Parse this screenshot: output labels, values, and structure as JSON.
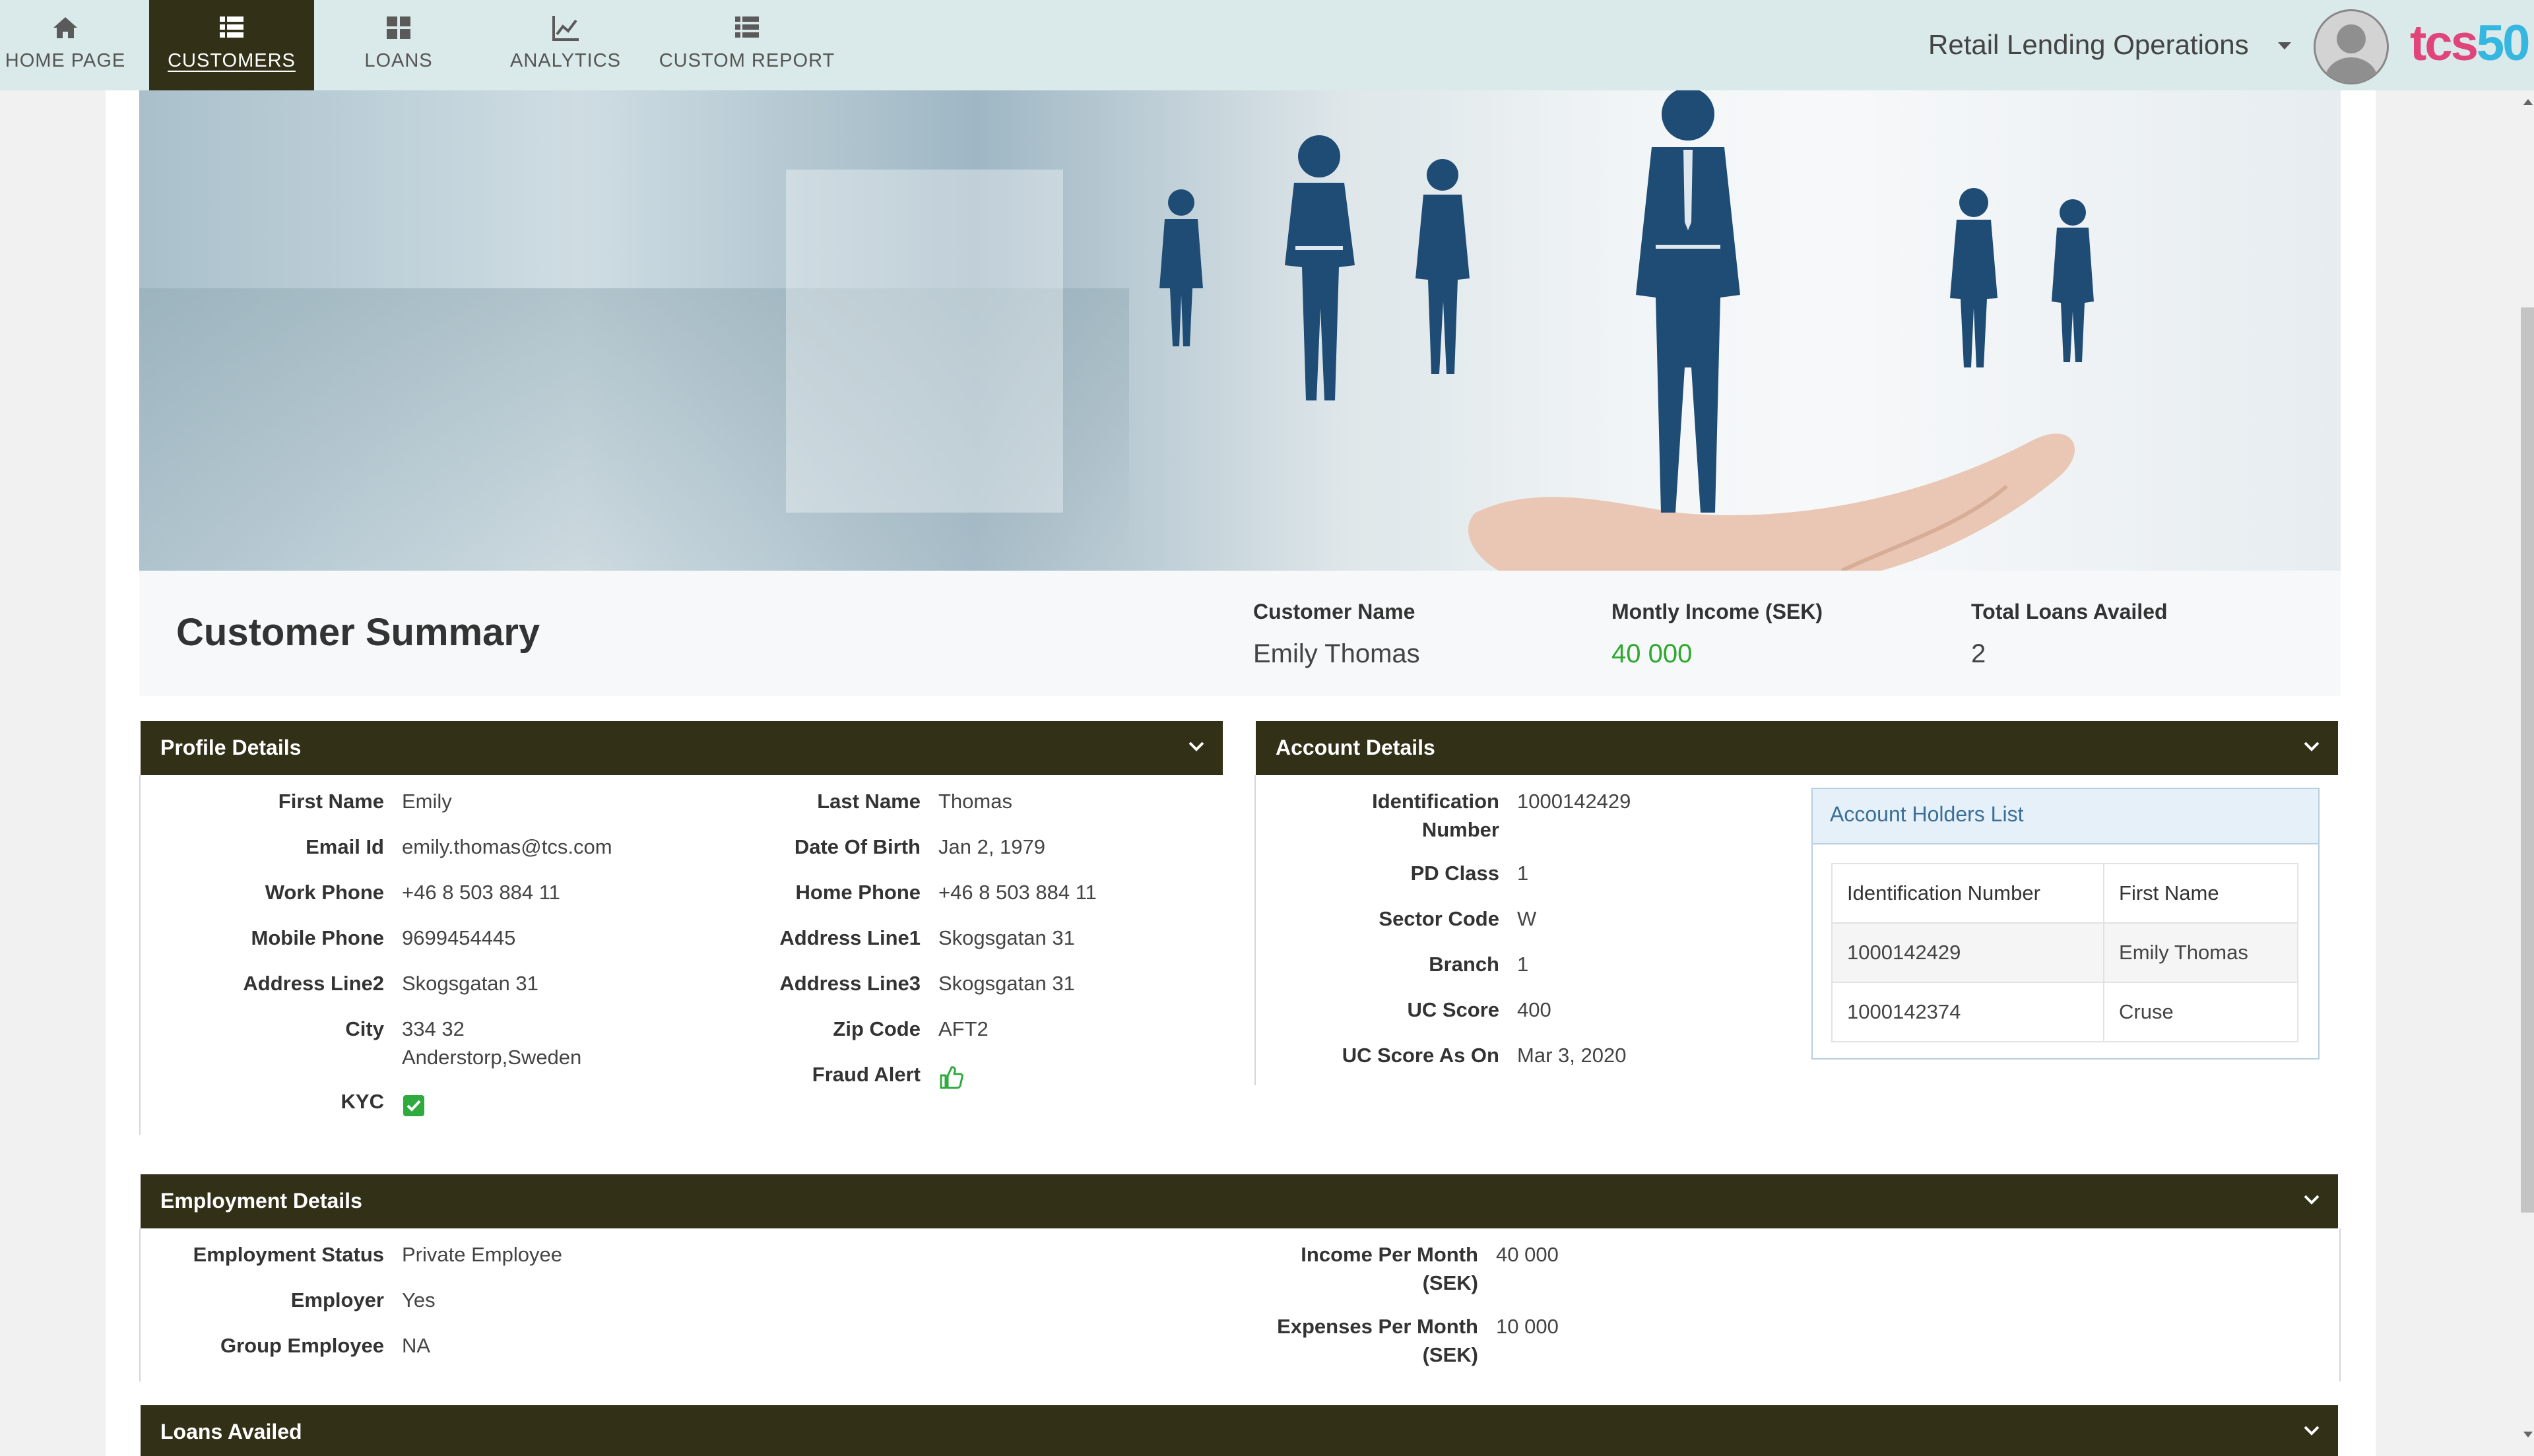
{
  "nav": {
    "items": [
      {
        "label": "HOME PAGE",
        "icon": "home-icon"
      },
      {
        "label": "CUSTOMERS",
        "icon": "list-icon",
        "active": true
      },
      {
        "label": "LOANS",
        "icon": "grid-icon"
      },
      {
        "label": "ANALYTICS",
        "icon": "line-chart-icon"
      },
      {
        "label": "CUSTOM REPORT",
        "icon": "list-icon"
      }
    ],
    "workspace": "Retail Lending Operations",
    "logo_left": "tcs",
    "logo_right": "50"
  },
  "summary": {
    "title": "Customer Summary",
    "customer_name_label": "Customer Name",
    "customer_name": "Emily Thomas",
    "income_label": "Montly Income (SEK)",
    "income": "40 000",
    "loans_label": "Total Loans Availed",
    "loans": "2"
  },
  "profile": {
    "title": "Profile Details",
    "first_name_label": "First Name",
    "first_name": "Emily",
    "last_name_label": "Last Name",
    "last_name": "Thomas",
    "email_label": "Email Id",
    "email": "emily.thomas@tcs.com",
    "dob_label": "Date Of Birth",
    "dob": "Jan 2, 1979",
    "work_phone_label": "Work Phone",
    "work_phone": "+46 8 503 884 11",
    "home_phone_label": "Home Phone",
    "home_phone": "+46 8 503 884 11",
    "mobile_label": "Mobile Phone",
    "mobile": "9699454445",
    "address1_label": "Address Line1",
    "address1": "Skogsgatan 31",
    "address2_label": "Address Line2",
    "address2": "Skogsgatan 31",
    "address3_label": "Address Line3",
    "address3": "Skogsgatan 31",
    "city_label": "City",
    "city_line1": "334 32",
    "city_line2": "Anderstorp,Sweden",
    "zip_label": "Zip Code",
    "zip": "AFT2",
    "kyc_label": "KYC",
    "kyc_checked": true,
    "fraud_label": "Fraud Alert",
    "fraud_icon": "thumbs-up-icon"
  },
  "account": {
    "title": "Account Details",
    "id_label_1": "Identification",
    "id_label_2": "Number",
    "id": "1000142429",
    "pd_label": "PD Class",
    "pd": "1",
    "sector_label": "Sector Code",
    "sector": "W",
    "branch_label": "Branch",
    "branch": "1",
    "uc_label": "UC Score",
    "uc": "400",
    "uc_asof_label": "UC Score As On",
    "uc_asof": "Mar 3, 2020",
    "holders": {
      "title": "Account Holders List",
      "columns": [
        "Identification Number",
        "First Name"
      ],
      "rows": [
        [
          "1000142429",
          "Emily Thomas"
        ],
        [
          "1000142374",
          "Cruse"
        ]
      ]
    }
  },
  "employment": {
    "title": "Employment Details",
    "status_label": "Employment Status",
    "status": "Private Employee",
    "employer_label": "Employer",
    "employer": "Yes",
    "group_label": "Group Employee",
    "group": "NA",
    "income_label_1": "Income Per Month",
    "income_label_2": "(SEK)",
    "income": "40 000",
    "expenses_label_1": "Expenses Per Month",
    "expenses_label_2": "(SEK)",
    "expenses": "10 000"
  },
  "loans_panel": {
    "title": "Loans Availed"
  },
  "colors": {
    "nav_bg": "#dae9e9",
    "nav_active": "#333018",
    "panel_header": "#333018",
    "accent_green": "#2ea82e",
    "link_blue": "#3a6f97"
  }
}
